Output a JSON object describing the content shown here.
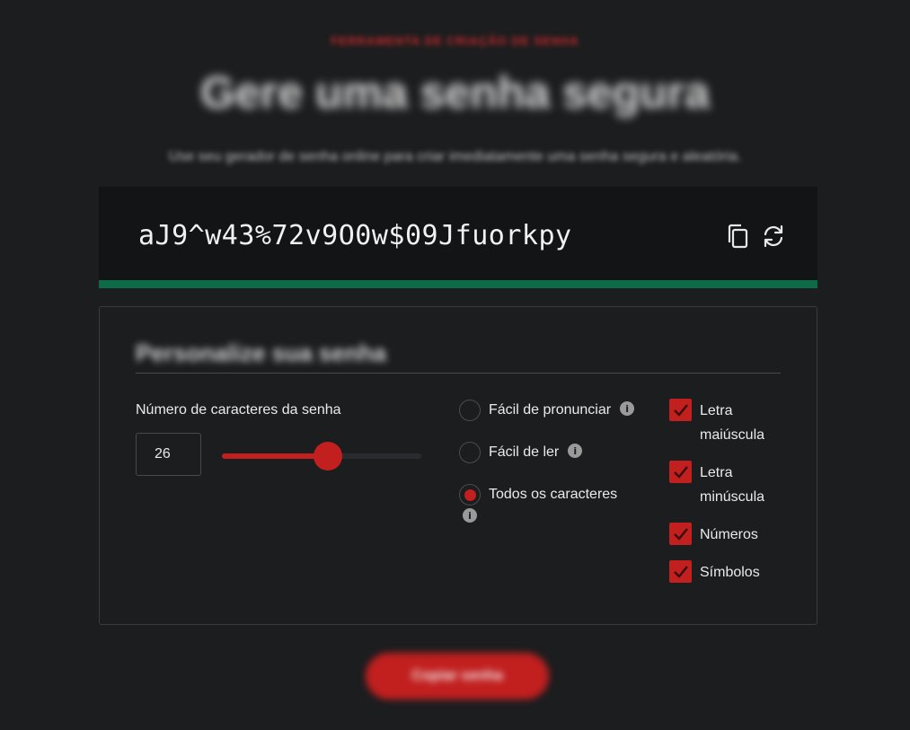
{
  "header": {
    "eyebrow": "FERRAMENTA DE CRIAÇÃO DE SENHA",
    "title": "Gere uma senha segura",
    "subtitle": "Use seu gerador de senha online para criar imediatamente uma senha segura e aleatória."
  },
  "password": {
    "value": "aJ9^w43%72v9O0w$09Jfuorkpy",
    "copy_icon": "copy-icon",
    "refresh_icon": "refresh-icon",
    "strength_color": "#0d6b47"
  },
  "panel": {
    "title": "Personalize sua senha",
    "length_label": "Número de caracteres da senha",
    "length_value": "26",
    "slider_fraction": 0.53
  },
  "char_options": [
    {
      "label": "Fácil de pronunciar",
      "selected": false
    },
    {
      "label": "Fácil de ler",
      "selected": false
    },
    {
      "label": "Todos os caracteres",
      "selected": true
    }
  ],
  "checkboxes": [
    {
      "label": "Letra maiúscula",
      "checked": true
    },
    {
      "label": "Letra minúscula",
      "checked": true
    },
    {
      "label": "Números",
      "checked": true
    },
    {
      "label": "Símbolos",
      "checked": true
    }
  ],
  "footer": {
    "copy_button": "Copiar senha"
  },
  "colors": {
    "accent": "#c21f1f",
    "background": "#1c1d1f"
  }
}
